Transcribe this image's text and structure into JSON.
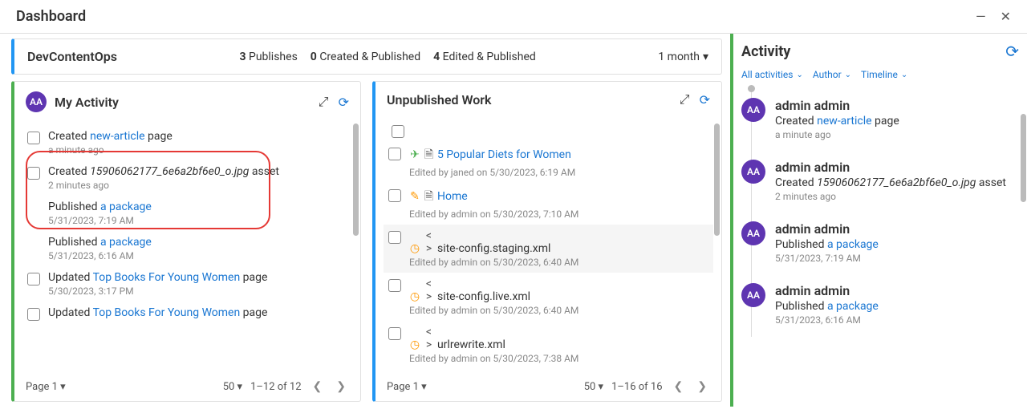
{
  "title": "Dashboard",
  "top": {
    "site": "DevContentOps",
    "stats": [
      {
        "n": "3",
        "lbl": "Publishes"
      },
      {
        "n": "0",
        "lbl": "Created & Published"
      },
      {
        "n": "4",
        "lbl": "Edited & Published"
      }
    ],
    "range": "1 month"
  },
  "myActivity": {
    "title": "My Activity",
    "avatar": "AA",
    "items": [
      {
        "pre": "Created ",
        "link": "new-article",
        "post": " page",
        "sub": "a minute ago",
        "ital": false
      },
      {
        "pre": "Created ",
        "link": "15906062177_6e6a2bf6e0_o.jpg",
        "post": " asset",
        "sub": "2 minutes ago",
        "ital": true
      },
      {
        "pre": "Published ",
        "link": "a package",
        "post": "",
        "sub": "5/31/2023, 7:19 AM",
        "ital": false,
        "nocheck": true
      },
      {
        "pre": "Published ",
        "link": "a package",
        "post": "",
        "sub": "5/31/2023, 6:16 AM",
        "ital": false,
        "nocheck": true
      },
      {
        "pre": "Updated ",
        "link": "Top Books For Young Women",
        "post": " page",
        "sub": "5/30/2023, 3:17 PM",
        "ital": false
      },
      {
        "pre": "Updated ",
        "link": "Top Books For Young Women",
        "post": " page",
        "sub": "",
        "ital": false
      }
    ],
    "pageLabel": "Page 1",
    "perPage": "50",
    "range": "1–12 of 12"
  },
  "unpub": {
    "title": "Unpublished Work",
    "items": [
      {
        "icons": [
          "send",
          "page"
        ],
        "title": "5 Popular Diets for Women",
        "sub": "Edited by janed on 5/30/2023, 6:19 AM",
        "link": true
      },
      {
        "icons": [
          "pencil",
          "page"
        ],
        "title": "Home",
        "sub": "Edited by admin on 5/30/2023, 7:10 AM",
        "link": true
      },
      {
        "icons": [
          "clock",
          "code"
        ],
        "title": "site-config.staging.xml",
        "sub": "Edited by admin on 5/30/2023, 6:40 AM",
        "link": false,
        "hov": true
      },
      {
        "icons": [
          "clock",
          "code"
        ],
        "title": "site-config.live.xml",
        "sub": "Edited by admin on 5/30/2023, 6:40 AM",
        "link": false
      },
      {
        "icons": [
          "clock",
          "code"
        ],
        "title": "urlrewrite.xml",
        "sub": "Edited by admin on 5/30/2023, 7:38 AM",
        "link": false
      }
    ],
    "pageLabel": "Page 1",
    "perPage": "50",
    "range": "1–16 of 16"
  },
  "activity": {
    "title": "Activity",
    "filters": [
      "All activities",
      "Author",
      "Timeline"
    ],
    "items": [
      {
        "av": "AA",
        "name": "admin admin",
        "pre": "Created ",
        "link": "new-article",
        "post": " page",
        "time": "a minute ago",
        "ital": false
      },
      {
        "av": "AA",
        "name": "admin admin",
        "pre": "Created ",
        "link": "15906062177_6e6a2bf6e0_o.jpg",
        "post": " asset",
        "time": "2 minutes ago",
        "ital": true
      },
      {
        "av": "AA",
        "name": "admin admin",
        "pre": "Published ",
        "link": "a package",
        "post": "",
        "time": "5/31/2023, 7:19 AM",
        "ital": false
      },
      {
        "av": "AA",
        "name": "admin admin",
        "pre": "Published ",
        "link": "a package",
        "post": "",
        "time": "5/31/2023, 6:16 AM",
        "ital": false
      }
    ]
  },
  "iconmap": {
    "send": "✈",
    "page": "🗎",
    "pencil": "✎",
    "clock": "◷",
    "code": "< >"
  }
}
